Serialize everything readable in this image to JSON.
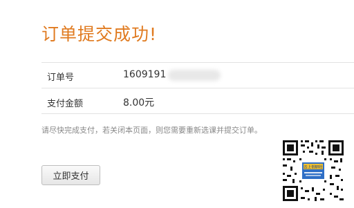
{
  "order": {
    "title": "订单提交成功!",
    "number_label": "订单号",
    "number_value": "1609191",
    "amount_label": "支付金额",
    "amount_value": "8.00元",
    "notice": "请尽快完成支付，若关闭本页面，则您需要重新选课并提交订单。",
    "pay_button_label": "立即支付"
  },
  "qr_code": {
    "logo_text": "云上创研社"
  },
  "colors": {
    "title": "#e07a1f",
    "qr_logo": "#2f6fc6"
  }
}
